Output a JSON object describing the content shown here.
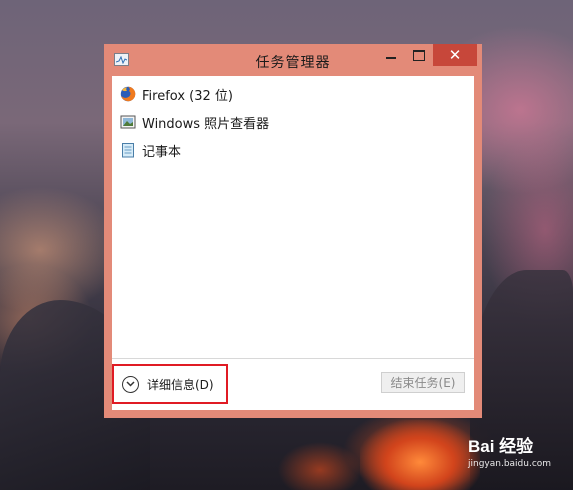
{
  "window": {
    "title": "任务管理器",
    "close_glyph": "✕",
    "accent_color": "#e38a78",
    "close_color": "#c7473a"
  },
  "tasks": [
    {
      "label": "Firefox (32 位)",
      "icon": "firefox-icon"
    },
    {
      "label": "Windows 照片查看器",
      "icon": "photo-viewer-icon"
    },
    {
      "label": "记事本",
      "icon": "notepad-icon"
    }
  ],
  "footer": {
    "details_label": "详细信息(D)",
    "end_task_label": "结束任务(E)",
    "highlight_color": "#e01b24"
  },
  "watermark": {
    "logo": "Bai 经验",
    "url": "jingyan.baidu.com"
  }
}
